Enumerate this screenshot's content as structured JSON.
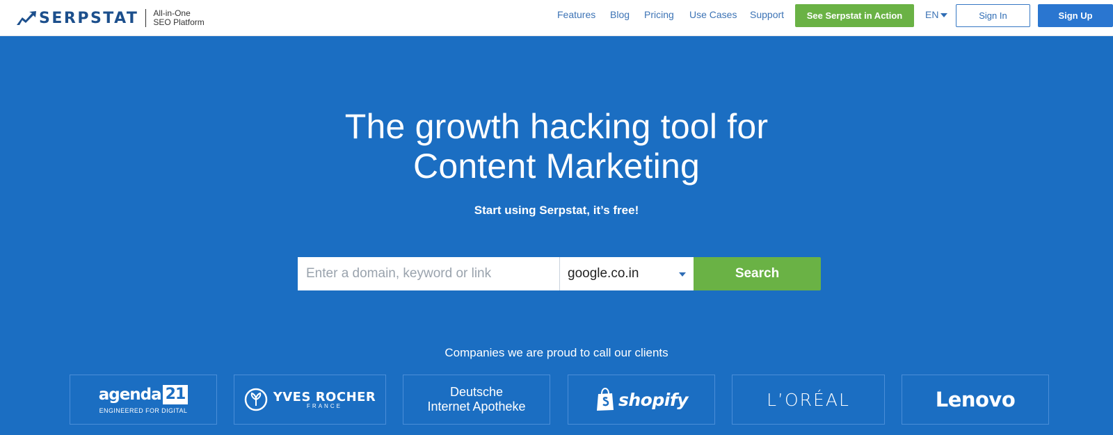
{
  "brand": {
    "name": "SERPSTAT",
    "tagline_line1": "All-in-One",
    "tagline_line2": "SEO Platform"
  },
  "nav": {
    "links": [
      "Features",
      "Blog",
      "Pricing",
      "Use Cases",
      "Support"
    ],
    "demo_button": "See Serpstat in Action",
    "language": "EN",
    "sign_in": "Sign In",
    "sign_up": "Sign Up"
  },
  "hero": {
    "title_line1": "The growth hacking tool for",
    "title_line2": "Content Marketing",
    "subtitle": "Start using Serpstat, it’s free!"
  },
  "search": {
    "placeholder": "Enter a domain, keyword or link",
    "value": "",
    "engine": "google.co.in",
    "button": "Search"
  },
  "clients": {
    "title": "Companies we are proud to call our clients",
    "logos": {
      "agenda_main": "agenda",
      "agenda_num": "21",
      "agenda_sub": "ENGINEERED FOR DIGITAL",
      "yves_name": "YVES ROCHER",
      "yves_sub": "FRANCE",
      "dia_line1": "Deutsche",
      "dia_line2": "Internet Apotheke",
      "shopify": "shopify",
      "loreal": "L’ORÉAL",
      "lenovo": "Lenovo"
    }
  },
  "colors": {
    "hero_bg": "#1b6ec2",
    "accent_green": "#6ab245",
    "brand_blue": "#1c4f8c",
    "signup_blue": "#2a76d0"
  },
  "icons": [
    "serpstat-logo-icon",
    "dropdown-caret-icon",
    "yves-rocher-emblem-icon",
    "shopify-bag-icon"
  ]
}
